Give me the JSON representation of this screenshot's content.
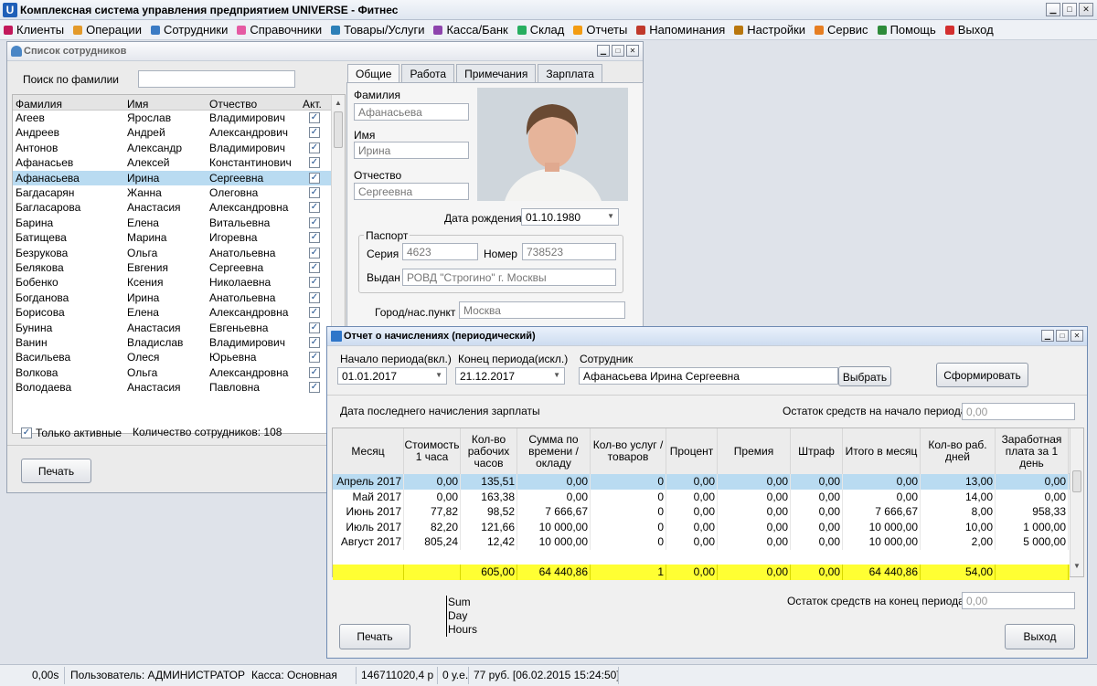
{
  "app": {
    "title": "Комплексная система управления предприятием UNIVERSE - Фитнес",
    "logo": "U"
  },
  "menu": [
    {
      "label": "Клиенты",
      "color": "#c2185b"
    },
    {
      "label": "Операции",
      "color": "#e39a2b"
    },
    {
      "label": "Сотрудники",
      "color": "#3b7bc4"
    },
    {
      "label": "Справочники",
      "color": "#e55aa3"
    },
    {
      "label": "Товары/Услуги",
      "color": "#2c7fb8"
    },
    {
      "label": "Касса/Банк",
      "color": "#8e44ad"
    },
    {
      "label": "Склад",
      "color": "#27ae60"
    },
    {
      "label": "Отчеты",
      "color": "#f39c12"
    },
    {
      "label": "Напоминания",
      "color": "#c0392b"
    },
    {
      "label": "Настройки",
      "color": "#b9770e"
    },
    {
      "label": "Сервис",
      "color": "#e67e22"
    },
    {
      "label": "Помощь",
      "color": "#2e8b3a"
    },
    {
      "label": "Выход",
      "color": "#d32f2f"
    }
  ],
  "employees": {
    "title": "Список сотрудников",
    "search_label": "Поиск по фамилии",
    "search_value": "",
    "columns": [
      "Фамилия",
      "Имя",
      "Отчество",
      "Акт."
    ],
    "rows": [
      [
        "Агеев",
        "Ярослав",
        "Владимирович"
      ],
      [
        "Андреев",
        "Андрей",
        "Александрович"
      ],
      [
        "Антонов",
        "Александр",
        "Владимирович"
      ],
      [
        "Афанасьев",
        "Алексей",
        "Константинович"
      ],
      [
        "Афанасьева",
        "Ирина",
        "Сергеевна"
      ],
      [
        "Багдасарян",
        "Жанна",
        "Олеговна"
      ],
      [
        "Багласарова",
        "Анастасия",
        "Александровна"
      ],
      [
        "Барина",
        "Елена",
        "Витальевна"
      ],
      [
        "Батищева",
        "Марина",
        "Игоревна"
      ],
      [
        "Безрукова",
        "Ольга",
        "Анатольевна"
      ],
      [
        "Белякова",
        "Евгения",
        "Сергеевна"
      ],
      [
        "Бобенко",
        "Ксения",
        "Николаевна"
      ],
      [
        "Богданова",
        "Ирина",
        "Анатольевна"
      ],
      [
        "Борисова",
        "Елена",
        "Александровна"
      ],
      [
        "Бунина",
        "Анастасия",
        "Евгеньевна"
      ],
      [
        "Ванин",
        "Владислав",
        "Владимирович"
      ],
      [
        "Васильева",
        "Олеся",
        "Юрьевна"
      ],
      [
        "Волкова",
        "Ольга",
        "Александровна"
      ],
      [
        "Володаева",
        "Анастасия",
        "Павловна"
      ]
    ],
    "selected_index": 4,
    "only_active_label": "Только активные",
    "count_label": "Количество сотрудников: 108",
    "print_label": "Печать",
    "tabs": [
      "Общие",
      "Работа",
      "Примечания",
      "Зарплата"
    ],
    "active_tab": 0,
    "detail": {
      "surname_label": "Фамилия",
      "surname": "Афанасьева",
      "name_label": "Имя",
      "name": "Ирина",
      "patronymic_label": "Отчество",
      "patronymic": "Сергеевна",
      "birth_label": "Дата рождения",
      "birth": "01.10.1980",
      "passport_label": "Паспорт",
      "series_label": "Серия",
      "series": "4623",
      "number_label": "Номер",
      "number": "738523",
      "issued_label": "Выдан",
      "issued": "РОВД \"Строгино\" г. Москвы",
      "city_label": "Город/нас.пункт",
      "city": "Москва"
    }
  },
  "report": {
    "title": "Отчет о начислениях (периодический)",
    "start_label": "Начало периода(вкл.)",
    "start": "01.01.2017",
    "end_label": "Конец периода(искл.)",
    "end": "21.12.2017",
    "employee_label": "Сотрудник",
    "employee": "Афанасьева Ирина Сергеевна",
    "choose_label": "Выбрать",
    "form_label": "Сформировать",
    "last_salary_label": "Дата последнего начисления зарплаты",
    "balance_start_label": "Остаток средств на начало периода",
    "balance_start": "0,00",
    "columns": [
      "Месяц",
      "Стоимость 1 часа",
      "Кол-во рабочих часов",
      "Сумма по времени / окладу",
      "Кол-во услуг / товаров",
      "Процент",
      "Премия",
      "Штраф",
      "Итого в месяц",
      "Кол-во раб. дней",
      "Заработная плата за 1 день"
    ],
    "rows": [
      [
        "Апрель 2017",
        "0,00",
        "135,51",
        "0,00",
        "0",
        "0,00",
        "0,00",
        "0,00",
        "0,00",
        "13,00",
        "0,00"
      ],
      [
        "Май 2017",
        "0,00",
        "163,38",
        "0,00",
        "0",
        "0,00",
        "0,00",
        "0,00",
        "0,00",
        "14,00",
        "0,00"
      ],
      [
        "Июнь 2017",
        "77,82",
        "98,52",
        "7 666,67",
        "0",
        "0,00",
        "0,00",
        "0,00",
        "7 666,67",
        "8,00",
        "958,33"
      ],
      [
        "Июль 2017",
        "82,20",
        "121,66",
        "10 000,00",
        "0",
        "0,00",
        "0,00",
        "0,00",
        "10 000,00",
        "10,00",
        "1 000,00"
      ],
      [
        "Август 2017",
        "805,24",
        "12,42",
        "10 000,00",
        "0",
        "0,00",
        "0,00",
        "0,00",
        "10 000,00",
        "2,00",
        "5 000,00"
      ]
    ],
    "totals": [
      "",
      "",
      "605,00",
      "64 440,86",
      "1",
      "0,00",
      "0,00",
      "0,00",
      "64 440,86",
      "54,00",
      ""
    ],
    "legend": [
      "Sum",
      "Day",
      "Hours"
    ],
    "balance_end_label": "Остаток средств на конец периода",
    "balance_end": "0,00",
    "print_label": "Печать",
    "exit_label": "Выход"
  },
  "status": {
    "time": "0,00s",
    "user": "Пользователь: АДМИНИСТРАТОР",
    "cash": "Касса: Основная",
    "amount": "146711020,4 р",
    "ue": "0 у.е.",
    "info": "77 руб. [06.02.2015 15:24:50]"
  }
}
